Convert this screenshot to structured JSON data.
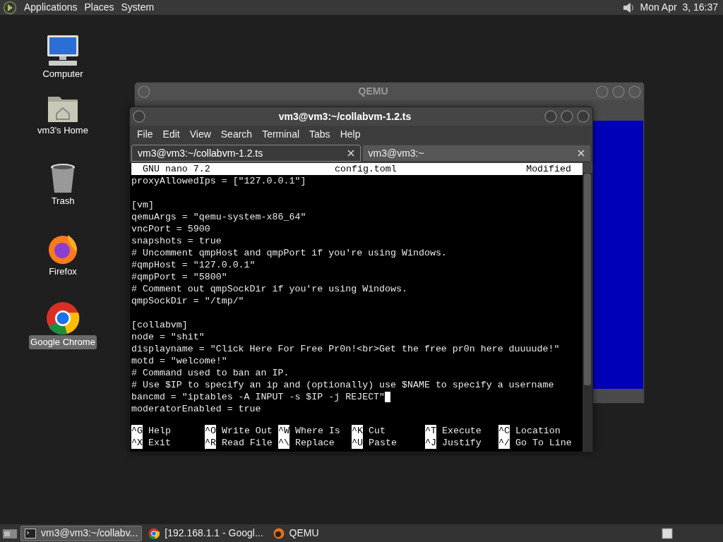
{
  "top_panel": {
    "menus": [
      "Applications",
      "Places",
      "System"
    ],
    "clock": "Mon Apr  3, 16:37"
  },
  "desktop_icons": [
    {
      "label": "Computer",
      "kind": "computer",
      "selected": false
    },
    {
      "label": "vm3's Home",
      "kind": "home",
      "selected": false
    },
    {
      "label": "Trash",
      "kind": "trash",
      "selected": false
    },
    {
      "label": "Firefox",
      "kind": "firefox",
      "selected": false
    },
    {
      "label": "Google Chrome",
      "kind": "chrome",
      "selected": true
    }
  ],
  "qemu_window": {
    "title": "QEMU"
  },
  "terminal": {
    "title": "vm3@vm3:~/collabvm-1.2.ts",
    "menu": [
      "File",
      "Edit",
      "View",
      "Search",
      "Terminal",
      "Tabs",
      "Help"
    ],
    "tabs": [
      {
        "label": "vm3@vm3:~/collabvm-1.2.ts",
        "selected": true
      },
      {
        "label": "vm3@vm3:~",
        "selected": false
      }
    ],
    "nano": {
      "version": "GNU nano 7.2",
      "filename": "config.toml",
      "status": "Modified",
      "lines": [
        {
          "kind": "text",
          "text": "proxyAllowedIps = [\"127.0.0.1\"]",
          "cursor": false
        },
        {
          "kind": "blank",
          "cursor": false
        },
        {
          "kind": "text",
          "text": "[vm]",
          "cursor": false
        },
        {
          "kind": "text",
          "text": "qemuArgs = \"qemu-system-x86_64\"",
          "cursor": false
        },
        {
          "kind": "text",
          "text": "vncPort = 5900",
          "cursor": false
        },
        {
          "kind": "text",
          "text": "snapshots = true",
          "cursor": false
        },
        {
          "kind": "text",
          "text": "# Uncomment qmpHost and qmpPort if you're using Windows.",
          "cursor": false
        },
        {
          "kind": "text",
          "text": "#qmpHost = \"127.0.0.1\"",
          "cursor": false
        },
        {
          "kind": "text",
          "text": "#qmpPort = \"5800\"",
          "cursor": false
        },
        {
          "kind": "text",
          "text": "# Comment out qmpSockDir if you're using Windows.",
          "cursor": false
        },
        {
          "kind": "text",
          "text": "qmpSockDir = \"/tmp/\"",
          "cursor": false
        },
        {
          "kind": "blank",
          "cursor": false
        },
        {
          "kind": "text",
          "text": "[collabvm]",
          "cursor": false
        },
        {
          "kind": "text",
          "text": "node = \"shit\"",
          "cursor": false
        },
        {
          "kind": "text",
          "text": "displayname = \"Click Here For Free Pr0n!<br>Get the free pr0n here duuuude!\"",
          "cursor": false
        },
        {
          "kind": "text",
          "text": "motd = \"welcome!\"",
          "cursor": false
        },
        {
          "kind": "text",
          "text": "# Command used to ban an IP.",
          "cursor": false
        },
        {
          "kind": "text",
          "text": "# Use $IP to specify an ip and (optionally) use $NAME to specify a username",
          "cursor": false
        },
        {
          "kind": "text",
          "text": "bancmd = \"iptables -A INPUT -s $IP -j REJECT\"",
          "cursor": true
        },
        {
          "kind": "text",
          "text": "moderatorEnabled = true",
          "cursor": false
        }
      ],
      "shortcuts": [
        {
          "key": "^G",
          "label": "Help"
        },
        {
          "key": "^O",
          "label": "Write Out"
        },
        {
          "key": "^W",
          "label": "Where Is"
        },
        {
          "key": "^K",
          "label": "Cut"
        },
        {
          "key": "^T",
          "label": "Execute"
        },
        {
          "key": "^C",
          "label": "Location"
        },
        {
          "key": "^X",
          "label": "Exit"
        },
        {
          "key": "^R",
          "label": "Read File"
        },
        {
          "key": "^\\",
          "label": "Replace"
        },
        {
          "key": "^U",
          "label": "Paste"
        },
        {
          "key": "^J",
          "label": "Justify"
        },
        {
          "key": "^/",
          "label": "Go To Line"
        }
      ]
    }
  },
  "taskbar": {
    "items": [
      {
        "label": "vm3@vm3:~/collabv...",
        "kind": "terminal",
        "selected": true
      },
      {
        "label": "[192.168.1.1 - Googl...",
        "kind": "chrome",
        "selected": false
      },
      {
        "label": "QEMU",
        "kind": "qemu",
        "selected": false
      }
    ]
  }
}
